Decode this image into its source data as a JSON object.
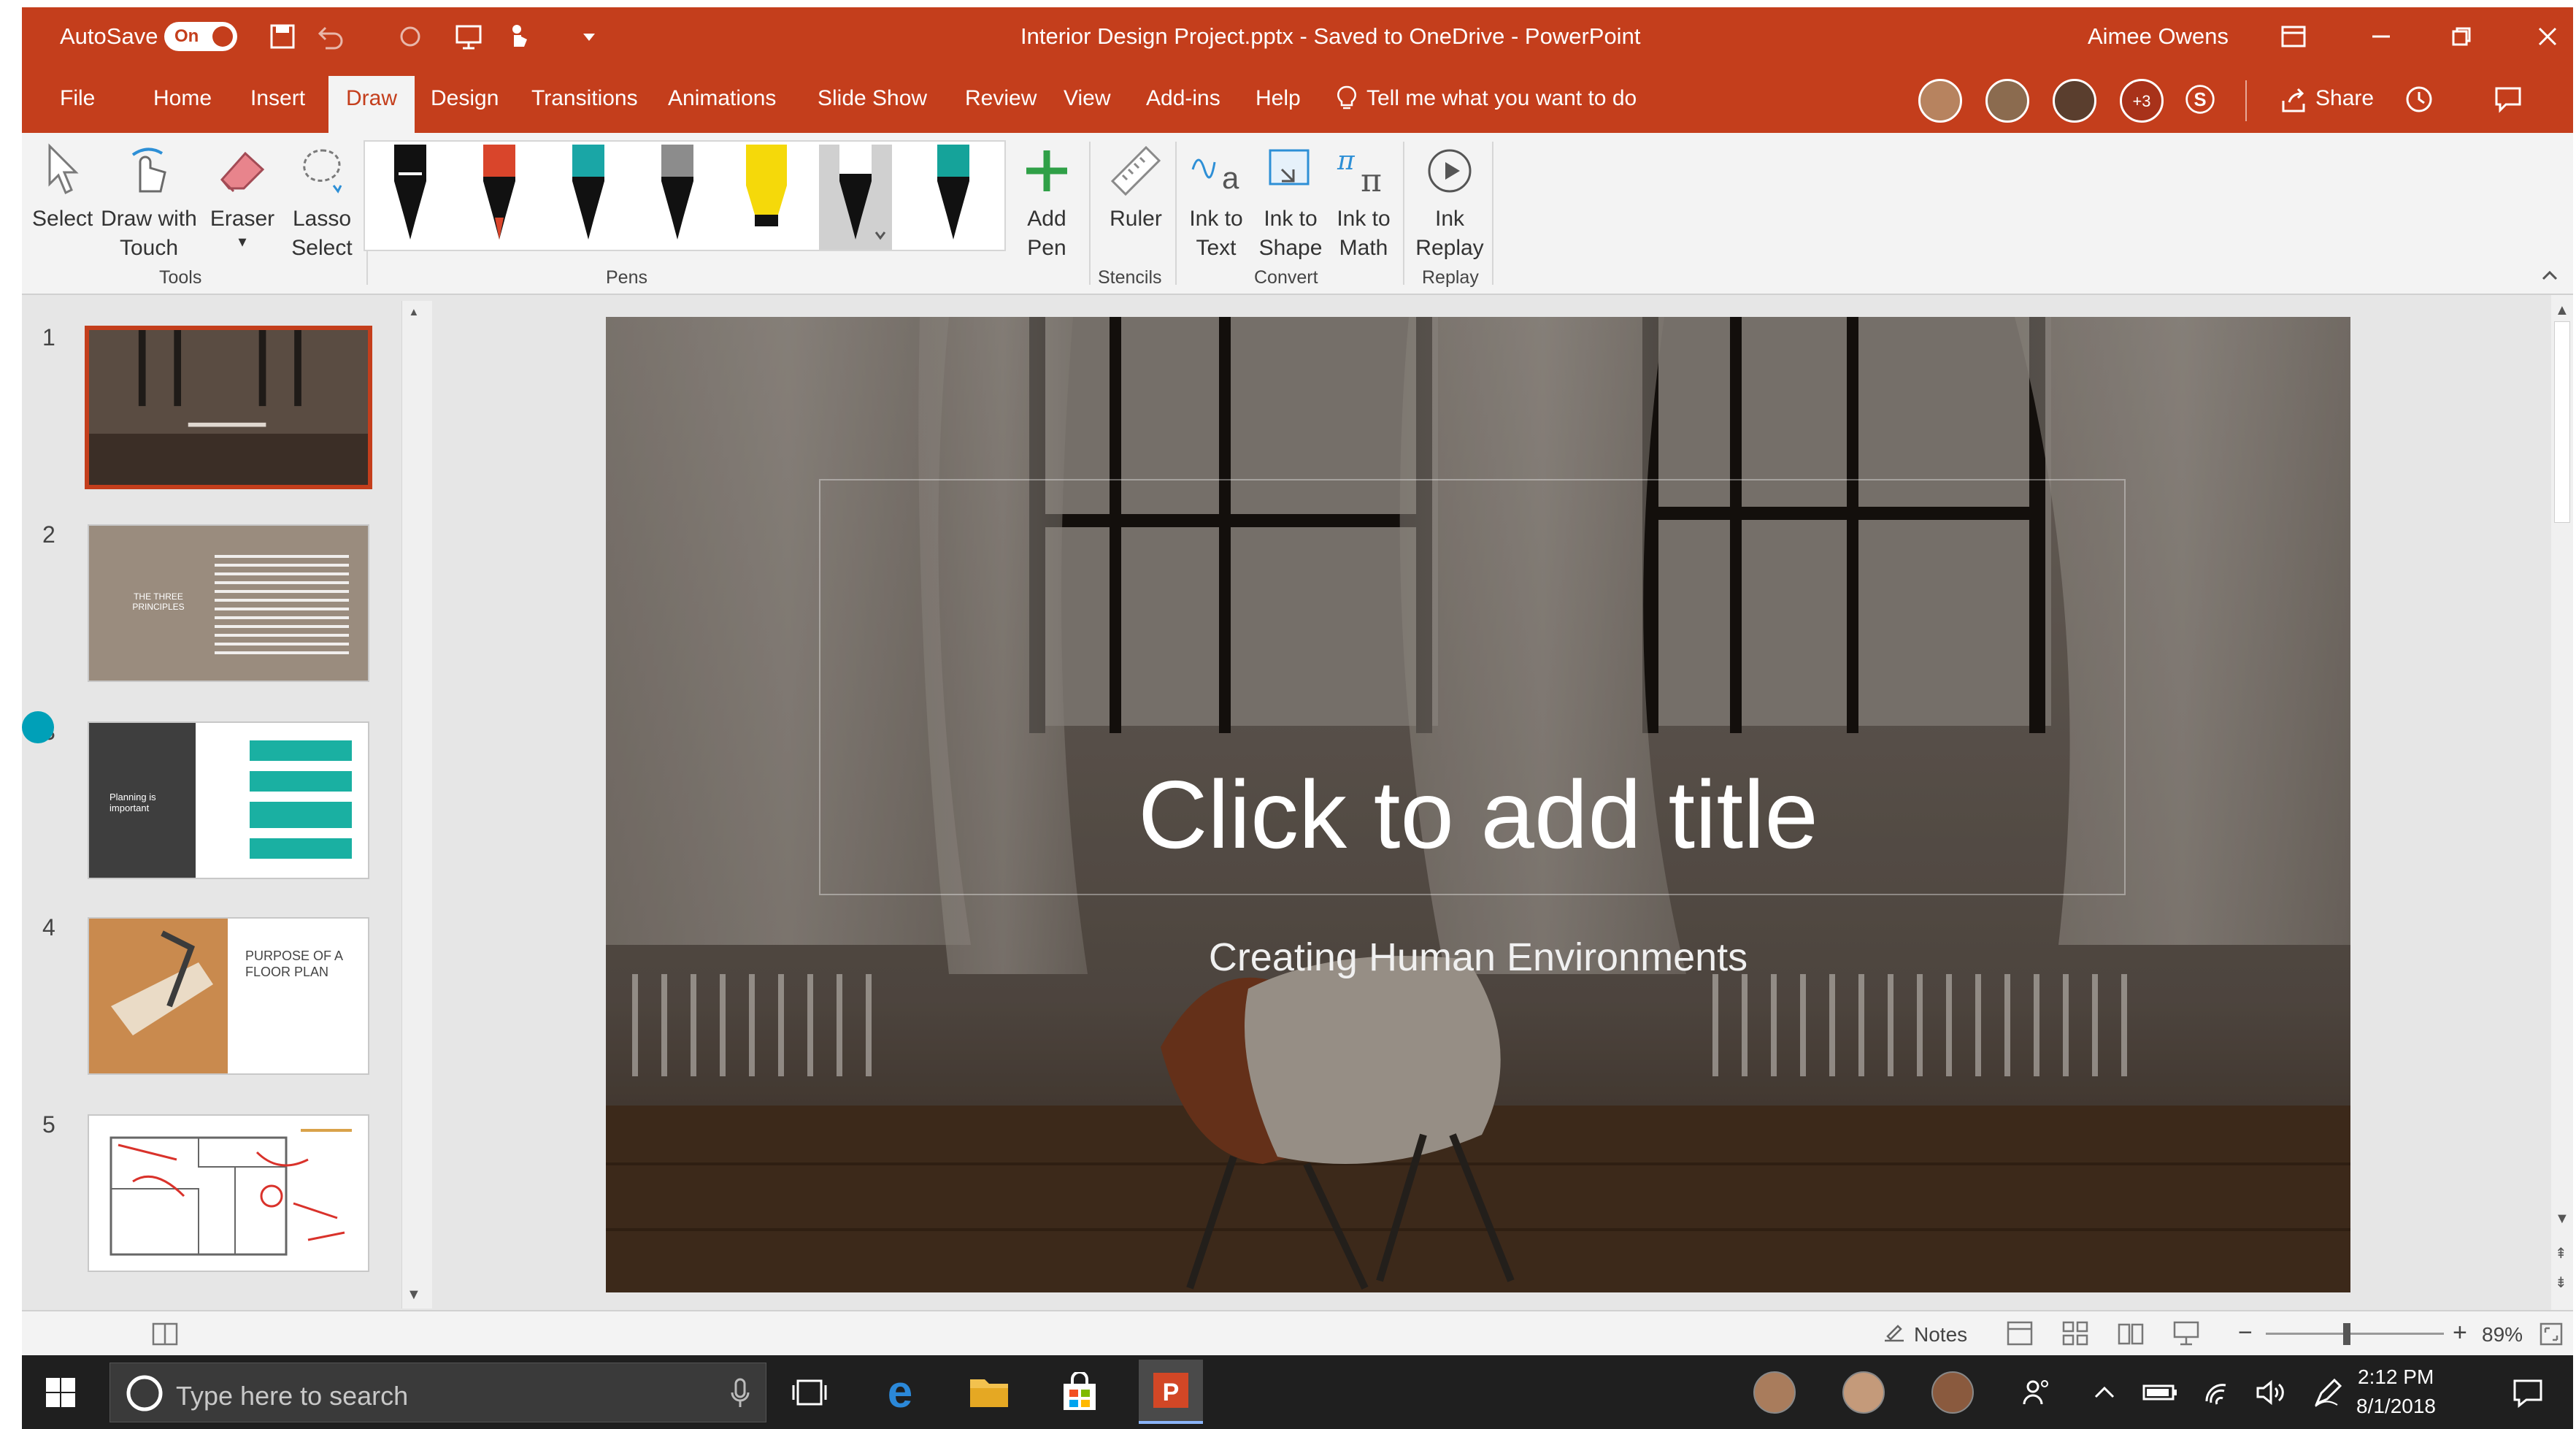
{
  "titlebar": {
    "autosave_label": "AutoSave",
    "autosave_state": "On",
    "doc_title": "Interior Design Project.pptx - Saved to OneDrive - PowerPoint",
    "user_name": "Aimee Owens"
  },
  "menu": {
    "tabs": [
      "File",
      "Home",
      "Insert",
      "Draw",
      "Design",
      "Transitions",
      "Animations",
      "Slide Show",
      "Review",
      "View",
      "Add-ins",
      "Help"
    ],
    "active_tab": "Draw",
    "tell_me": "Tell me what you want to do",
    "more_collaborators": "+3",
    "share_label": "Share"
  },
  "ribbon": {
    "tools": {
      "select": "Select",
      "draw_touch": "Draw with Touch",
      "eraser": "Eraser",
      "lasso": "Lasso Select",
      "group": "Tools"
    },
    "pens": {
      "group": "Pens",
      "colors": [
        "#111111",
        "#d9452b",
        "#1aa6a6",
        "#8c8c8c",
        "#f5d90a",
        "#111111",
        "#15a39a"
      ],
      "add_pen": "Add Pen"
    },
    "stencils": {
      "ruler": "Ruler",
      "group": "Stencils"
    },
    "convert": {
      "ink_text": "Ink to Text",
      "ink_shape": "Ink to Shape",
      "ink_math": "Ink to Math",
      "group": "Convert"
    },
    "replay": {
      "ink_replay": "Ink Replay",
      "group": "Replay"
    }
  },
  "thumbnails": {
    "numbers": [
      "1",
      "2",
      "3",
      "4",
      "5"
    ],
    "slide2_title": "THE THREE PRINCIPLES",
    "slide3_title": "Planning is important",
    "slide4_title": "PURPOSE OF A FLOOR PLAN"
  },
  "slide": {
    "title": "Click to add title",
    "subtitle": "Creating Human Environments"
  },
  "statusbar": {
    "notes": "Notes",
    "zoom": "89%"
  },
  "taskbar": {
    "search_placeholder": "Type here to search",
    "time": "2:12 PM",
    "date": "8/1/2018"
  },
  "colors": {
    "accent": "#c43e1c",
    "teal": "#00a0b8"
  }
}
